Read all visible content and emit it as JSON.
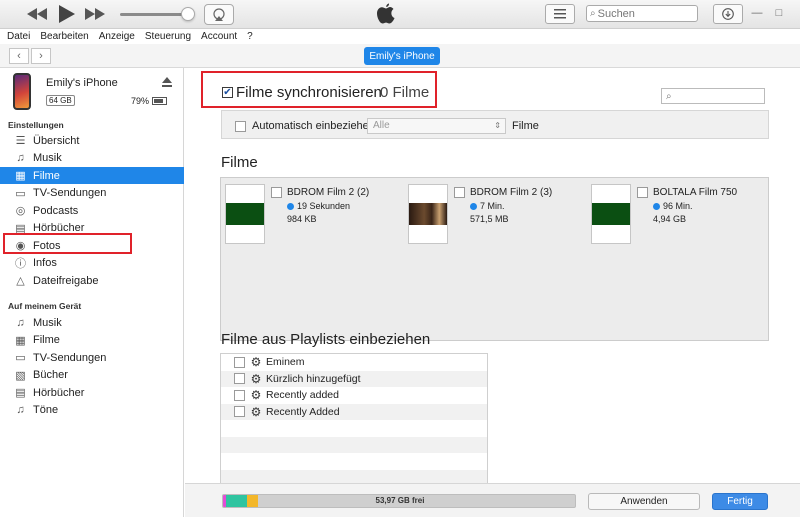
{
  "menu": [
    "Datei",
    "Bearbeiten",
    "Anzeige",
    "Steuerung",
    "Account",
    "?"
  ],
  "toolbar": {
    "search_placeholder": "Suchen",
    "volume_level": 0.88
  },
  "nav": {
    "device_pill": "Emily's iPhone"
  },
  "device": {
    "name": "Emily's iPhone",
    "capacity": "64 GB",
    "battery": "79%"
  },
  "sidebar": {
    "settings_title": "Einstellungen",
    "settings_items": [
      {
        "label": "Übersicht",
        "icon": "summary-icon"
      },
      {
        "label": "Musik",
        "icon": "music-note-icon"
      },
      {
        "label": "Filme",
        "icon": "film-icon"
      },
      {
        "label": "TV-Sendungen",
        "icon": "tv-icon"
      },
      {
        "label": "Podcasts",
        "icon": "podcast-icon"
      },
      {
        "label": "Hörbücher",
        "icon": "audiobook-icon"
      },
      {
        "label": "Fotos",
        "icon": "camera-icon"
      },
      {
        "label": "Infos",
        "icon": "info-icon"
      },
      {
        "label": "Dateifreigabe",
        "icon": "file-sharing-icon"
      }
    ],
    "device_title": "Auf meinem Gerät",
    "device_items": [
      {
        "label": "Musik",
        "icon": "music-note-icon"
      },
      {
        "label": "Filme",
        "icon": "film-icon"
      },
      {
        "label": "TV-Sendungen",
        "icon": "tv-icon"
      },
      {
        "label": "Bücher",
        "icon": "book-icon"
      },
      {
        "label": "Hörbücher",
        "icon": "audiobook-icon"
      },
      {
        "label": "Töne",
        "icon": "bell-icon"
      }
    ]
  },
  "main": {
    "sync_title": "Filme synchronisieren",
    "sync_count": "0 Filme",
    "auto_label": "Automatisch einbeziehen",
    "auto_select": "Alle",
    "auto_suffix": "Filme",
    "films_heading": "Filme",
    "films": [
      {
        "title": "BDROM Film 2 (2)",
        "duration": "19 Sekunden",
        "size": "984 KB"
      },
      {
        "title": "BDROM Film 2 (3)",
        "duration": "7 Min.",
        "size": "571,5 MB"
      },
      {
        "title": "BOLTALA Film 750",
        "duration": "96 Min.",
        "size": "4,94 GB"
      }
    ],
    "playlists_heading": "Filme aus Playlists einbeziehen",
    "playlists": [
      "Eminem",
      "Kürzlich hinzugefügt",
      "Recently added",
      "Recently Added"
    ]
  },
  "bottom": {
    "storage_free": "53,97 GB frei",
    "apply": "Anwenden",
    "done": "Fertig"
  },
  "colors": {
    "accent": "#1f86e8",
    "highlight": "#e0222a"
  }
}
